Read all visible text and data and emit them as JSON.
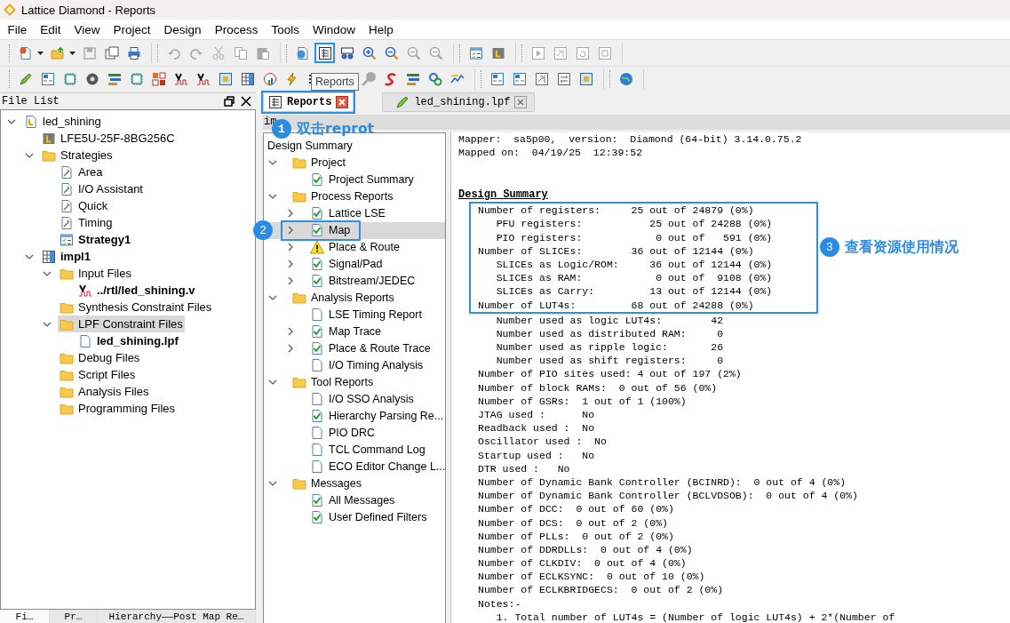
{
  "window": {
    "title": "Lattice Diamond - Reports"
  },
  "menu": [
    "File",
    "Edit",
    "View",
    "Project",
    "Design",
    "Process",
    "Tools",
    "Window",
    "Help"
  ],
  "toolbars": [
    {
      "groups": [
        [
          {
            "disabled": false,
            "selected": false,
            "dropdown": true
          },
          {
            "disabled": false,
            "selected": false,
            "dropdown": true
          },
          {
            "disabled": true,
            "selected": false
          },
          {
            "disabled": false,
            "selected": false
          },
          {
            "disabled": false,
            "selected": false
          }
        ],
        [
          {
            "disabled": true,
            "selected": false
          },
          {
            "disabled": true,
            "selected": false
          },
          {
            "disabled": true,
            "selected": false
          },
          {
            "disabled": true,
            "selected": false
          },
          {
            "disabled": true,
            "selected": false
          }
        ],
        [
          {
            "disabled": false,
            "selected": false
          },
          {
            "disabled": false,
            "selected": true
          },
          {
            "disabled": false,
            "selected": false
          },
          {
            "disabled": false,
            "selected": false
          },
          {
            "disabled": false,
            "selected": false
          },
          {
            "disabled": true,
            "selected": false
          },
          {
            "disabled": true,
            "selected": false
          }
        ],
        [
          {
            "disabled": false,
            "selected": false
          },
          {
            "disabled": false,
            "selected": false
          }
        ],
        [
          {
            "disabled": true,
            "selected": false
          },
          {
            "disabled": true,
            "selected": false
          },
          {
            "disabled": true,
            "selected": false
          },
          {
            "disabled": true,
            "selected": false
          }
        ]
      ]
    },
    {
      "groups": [
        [
          {
            "disabled": false,
            "selected": false
          },
          {
            "disabled": false,
            "selected": false
          },
          {
            "disabled": false,
            "selected": false
          },
          {
            "disabled": false,
            "selected": false
          },
          {
            "disabled": false,
            "selected": false
          },
          {
            "disabled": false,
            "selected": false
          },
          {
            "disabled": false,
            "selected": false
          },
          {
            "disabled": false,
            "selected": false
          },
          {
            "disabled": false,
            "selected": false
          },
          {
            "disabled": false,
            "selected": false
          },
          {
            "disabled": false,
            "selected": false
          },
          {
            "disabled": false,
            "selected": false
          },
          {
            "disabled": false,
            "selected": false
          },
          {
            "disabled": false,
            "selected": false
          },
          {
            "disabled": true,
            "selected": false
          },
          {
            "disabled": false,
            "selected": false
          },
          {
            "disabled": false,
            "selected": false
          },
          {
            "disabled": false,
            "selected": false
          },
          {
            "disabled": false,
            "selected": false
          }
        ],
        [
          {
            "disabled": false,
            "selected": false
          },
          {
            "disabled": false,
            "selected": false
          },
          {
            "disabled": false,
            "selected": false
          },
          {
            "disabled": false,
            "selected": false
          },
          {
            "disabled": false,
            "selected": false
          }
        ],
        [
          {
            "disabled": false,
            "selected": false
          }
        ]
      ]
    }
  ],
  "tooltip": "Reports",
  "file_list": {
    "title": "File List",
    "items": [
      {
        "label": "led_shining",
        "kind": "project",
        "expanded": true,
        "active": false,
        "selected": false,
        "children": [
          {
            "label": "LFE5U-25F-8BG256C",
            "kind": "device",
            "active": false,
            "selected": false
          },
          {
            "label": "Strategies",
            "kind": "folder",
            "expanded": true,
            "active": false,
            "selected": false,
            "children": [
              {
                "label": "Area",
                "kind": "strategy",
                "active": false,
                "selected": false
              },
              {
                "label": "I/O Assistant",
                "kind": "strategy",
                "active": false,
                "selected": false
              },
              {
                "label": "Quick",
                "kind": "strategy",
                "active": false,
                "selected": false
              },
              {
                "label": "Timing",
                "kind": "strategy",
                "active": false,
                "selected": false
              },
              {
                "label": "Strategy1",
                "kind": "active-strategy",
                "active": true,
                "selected": false
              }
            ]
          },
          {
            "label": "impl1",
            "kind": "implementation",
            "expanded": true,
            "active": true,
            "selected": false,
            "children": [
              {
                "label": "Input Files",
                "kind": "folder",
                "expanded": true,
                "active": false,
                "selected": false,
                "children": [
                  {
                    "label": "../rtl/led_shining.v",
                    "kind": "verilog",
                    "active": true,
                    "selected": false
                  }
                ]
              },
              {
                "label": "Synthesis Constraint Files",
                "kind": "folder",
                "active": false,
                "selected": false
              },
              {
                "label": "LPF Constraint Files",
                "kind": "folder",
                "expanded": true,
                "active": false,
                "selected": true,
                "children": [
                  {
                    "label": "led_shining.lpf",
                    "kind": "file",
                    "active": true,
                    "selected": false
                  }
                ]
              },
              {
                "label": "Debug Files",
                "kind": "folder",
                "active": false,
                "selected": false
              },
              {
                "label": "Script Files",
                "kind": "folder",
                "active": false,
                "selected": false
              },
              {
                "label": "Analysis Files",
                "kind": "folder",
                "active": false,
                "selected": false
              },
              {
                "label": "Programming Files",
                "kind": "folder",
                "active": false,
                "selected": false
              }
            ]
          }
        ]
      }
    ]
  },
  "bottom_tabs": [
    {
      "label": "Fi…",
      "selected": true
    },
    {
      "label": "Pr…",
      "selected": false
    },
    {
      "label": "Hierarchy——Post Map Re…",
      "selected": false
    }
  ],
  "editor_tabs": [
    {
      "label": "Reports",
      "selected": true,
      "callout": {
        "number": "1",
        "text": "双击reprot"
      }
    },
    {
      "label": "led_shining.lpf",
      "selected": false
    }
  ],
  "report_path": "im",
  "report_tree": {
    "title": "Design Summary",
    "items": [
      {
        "label": "Project",
        "kind": "folder",
        "expanded": true,
        "selected": false,
        "children": [
          {
            "label": "Project Summary",
            "kind": "passed",
            "selected": false
          }
        ]
      },
      {
        "label": "Process Reports",
        "kind": "folder",
        "expanded": true,
        "selected": false,
        "children": [
          {
            "label": "Lattice LSE",
            "kind": "passed",
            "expanded": false,
            "selected": false
          },
          {
            "label": "Map",
            "kind": "passed",
            "expanded": false,
            "selected": true,
            "callout": {
              "number": "2"
            }
          },
          {
            "label": "Place & Route",
            "kind": "warning",
            "expanded": false,
            "selected": false
          },
          {
            "label": "Signal/Pad",
            "kind": "passed",
            "expanded": false,
            "selected": false
          },
          {
            "label": "Bitstream/JEDEC",
            "kind": "passed",
            "expanded": false,
            "selected": false
          }
        ]
      },
      {
        "label": "Analysis Reports",
        "kind": "folder",
        "expanded": true,
        "selected": false,
        "children": [
          {
            "label": "LSE Timing Report",
            "kind": "document",
            "selected": false
          },
          {
            "label": "Map Trace",
            "kind": "passed",
            "expanded": false,
            "selected": false
          },
          {
            "label": "Place & Route Trace",
            "kind": "passed",
            "expanded": false,
            "selected": false
          },
          {
            "label": "I/O Timing Analysis",
            "kind": "document",
            "selected": false
          }
        ]
      },
      {
        "label": "Tool Reports",
        "kind": "folder",
        "expanded": true,
        "selected": false,
        "children": [
          {
            "label": "I/O SSO Analysis",
            "kind": "document",
            "selected": false
          },
          {
            "label": "Hierarchy Parsing Re...",
            "kind": "passed",
            "selected": false
          },
          {
            "label": "PIO DRC",
            "kind": "document",
            "selected": false
          },
          {
            "label": "TCL Command Log",
            "kind": "document",
            "selected": false
          },
          {
            "label": "ECO Editor Change L...",
            "kind": "document",
            "selected": false
          }
        ]
      },
      {
        "label": "Messages",
        "kind": "folder",
        "expanded": true,
        "selected": false,
        "children": [
          {
            "label": "All Messages",
            "kind": "passed",
            "selected": false
          },
          {
            "label": "User Defined Filters",
            "kind": "passed",
            "selected": false
          }
        ]
      }
    ]
  },
  "report": {
    "header_lines": [
      "Mapper:  sa5p00,  version:  Diamond (64-bit) 3.14.0.75.2",
      "Mapped on:  04/19/25  12:39:52"
    ],
    "heading": "Design Summary",
    "highlight": {
      "callout": {
        "number": "3",
        "text": "查看资源使用情况"
      },
      "lines": [
        "Number of registers:     25 out of 24879 (0%)",
        "   PFU registers:           25 out of 24288 (0%)",
        "   PIO registers:            0 out of   591 (0%)",
        "Number of SLICEs:        36 out of 12144 (0%)",
        "   SLICEs as Logic/ROM:     36 out of 12144 (0%)",
        "   SLICEs as RAM:            0 out of  9108 (0%)",
        "   SLICEs as Carry:         13 out of 12144 (0%)",
        "Number of LUT4s:         68 out of 24288 (0%)"
      ]
    },
    "lines": [
      "   Number used as logic LUT4s:        42",
      "   Number used as distributed RAM:     0",
      "   Number used as ripple logic:       26",
      "   Number used as shift registers:     0",
      "Number of PIO sites used: 4 out of 197 (2%)",
      "Number of block RAMs:  0 out of 56 (0%)",
      "Number of GSRs:  1 out of 1 (100%)",
      "JTAG used :      No",
      "Readback used :  No",
      "Oscillator used :  No",
      "Startup used :   No",
      "DTR used :   No",
      "Number of Dynamic Bank Controller (BCINRD):  0 out of 4 (0%)",
      "Number of Dynamic Bank Controller (BCLVDSOB):  0 out of 4 (0%)",
      "Number of DCC:  0 out of 60 (0%)",
      "Number of DCS:  0 out of 2 (0%)",
      "Number of PLLs:  0 out of 2 (0%)",
      "Number of DDRDLLs:  0 out of 4 (0%)",
      "Number of CLKDIV:  0 out of 4 (0%)",
      "Number of ECLKSYNC:  0 out of 10 (0%)",
      "Number of ECLKBRIDGECS:  0 out of 2 (0%)",
      "Notes:-",
      "   1. Total number of LUT4s = (Number of logic LUT4s) + 2*(Number of"
    ]
  }
}
